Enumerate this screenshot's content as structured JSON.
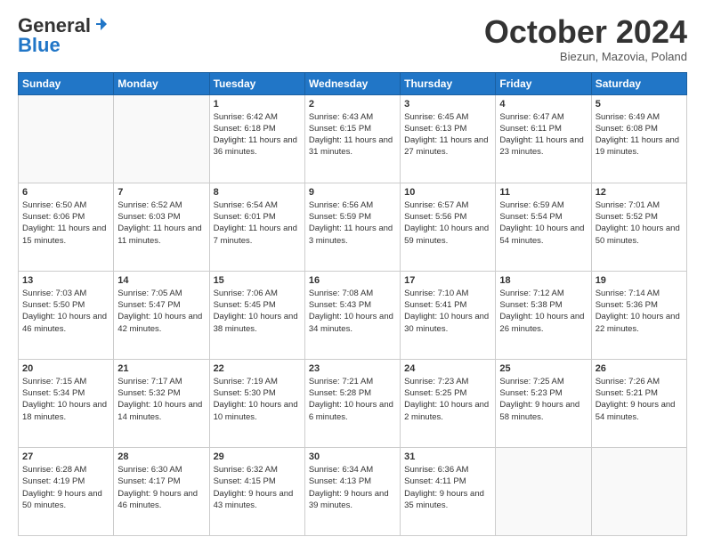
{
  "header": {
    "logo_line1": "General",
    "logo_line2": "Blue",
    "month": "October 2024",
    "location": "Biezun, Mazovia, Poland"
  },
  "days_of_week": [
    "Sunday",
    "Monday",
    "Tuesday",
    "Wednesday",
    "Thursday",
    "Friday",
    "Saturday"
  ],
  "weeks": [
    [
      {
        "num": "",
        "info": ""
      },
      {
        "num": "",
        "info": ""
      },
      {
        "num": "1",
        "info": "Sunrise: 6:42 AM\nSunset: 6:18 PM\nDaylight: 11 hours and 36 minutes."
      },
      {
        "num": "2",
        "info": "Sunrise: 6:43 AM\nSunset: 6:15 PM\nDaylight: 11 hours and 31 minutes."
      },
      {
        "num": "3",
        "info": "Sunrise: 6:45 AM\nSunset: 6:13 PM\nDaylight: 11 hours and 27 minutes."
      },
      {
        "num": "4",
        "info": "Sunrise: 6:47 AM\nSunset: 6:11 PM\nDaylight: 11 hours and 23 minutes."
      },
      {
        "num": "5",
        "info": "Sunrise: 6:49 AM\nSunset: 6:08 PM\nDaylight: 11 hours and 19 minutes."
      }
    ],
    [
      {
        "num": "6",
        "info": "Sunrise: 6:50 AM\nSunset: 6:06 PM\nDaylight: 11 hours and 15 minutes."
      },
      {
        "num": "7",
        "info": "Sunrise: 6:52 AM\nSunset: 6:03 PM\nDaylight: 11 hours and 11 minutes."
      },
      {
        "num": "8",
        "info": "Sunrise: 6:54 AM\nSunset: 6:01 PM\nDaylight: 11 hours and 7 minutes."
      },
      {
        "num": "9",
        "info": "Sunrise: 6:56 AM\nSunset: 5:59 PM\nDaylight: 11 hours and 3 minutes."
      },
      {
        "num": "10",
        "info": "Sunrise: 6:57 AM\nSunset: 5:56 PM\nDaylight: 10 hours and 59 minutes."
      },
      {
        "num": "11",
        "info": "Sunrise: 6:59 AM\nSunset: 5:54 PM\nDaylight: 10 hours and 54 minutes."
      },
      {
        "num": "12",
        "info": "Sunrise: 7:01 AM\nSunset: 5:52 PM\nDaylight: 10 hours and 50 minutes."
      }
    ],
    [
      {
        "num": "13",
        "info": "Sunrise: 7:03 AM\nSunset: 5:50 PM\nDaylight: 10 hours and 46 minutes."
      },
      {
        "num": "14",
        "info": "Sunrise: 7:05 AM\nSunset: 5:47 PM\nDaylight: 10 hours and 42 minutes."
      },
      {
        "num": "15",
        "info": "Sunrise: 7:06 AM\nSunset: 5:45 PM\nDaylight: 10 hours and 38 minutes."
      },
      {
        "num": "16",
        "info": "Sunrise: 7:08 AM\nSunset: 5:43 PM\nDaylight: 10 hours and 34 minutes."
      },
      {
        "num": "17",
        "info": "Sunrise: 7:10 AM\nSunset: 5:41 PM\nDaylight: 10 hours and 30 minutes."
      },
      {
        "num": "18",
        "info": "Sunrise: 7:12 AM\nSunset: 5:38 PM\nDaylight: 10 hours and 26 minutes."
      },
      {
        "num": "19",
        "info": "Sunrise: 7:14 AM\nSunset: 5:36 PM\nDaylight: 10 hours and 22 minutes."
      }
    ],
    [
      {
        "num": "20",
        "info": "Sunrise: 7:15 AM\nSunset: 5:34 PM\nDaylight: 10 hours and 18 minutes."
      },
      {
        "num": "21",
        "info": "Sunrise: 7:17 AM\nSunset: 5:32 PM\nDaylight: 10 hours and 14 minutes."
      },
      {
        "num": "22",
        "info": "Sunrise: 7:19 AM\nSunset: 5:30 PM\nDaylight: 10 hours and 10 minutes."
      },
      {
        "num": "23",
        "info": "Sunrise: 7:21 AM\nSunset: 5:28 PM\nDaylight: 10 hours and 6 minutes."
      },
      {
        "num": "24",
        "info": "Sunrise: 7:23 AM\nSunset: 5:25 PM\nDaylight: 10 hours and 2 minutes."
      },
      {
        "num": "25",
        "info": "Sunrise: 7:25 AM\nSunset: 5:23 PM\nDaylight: 9 hours and 58 minutes."
      },
      {
        "num": "26",
        "info": "Sunrise: 7:26 AM\nSunset: 5:21 PM\nDaylight: 9 hours and 54 minutes."
      }
    ],
    [
      {
        "num": "27",
        "info": "Sunrise: 6:28 AM\nSunset: 4:19 PM\nDaylight: 9 hours and 50 minutes."
      },
      {
        "num": "28",
        "info": "Sunrise: 6:30 AM\nSunset: 4:17 PM\nDaylight: 9 hours and 46 minutes."
      },
      {
        "num": "29",
        "info": "Sunrise: 6:32 AM\nSunset: 4:15 PM\nDaylight: 9 hours and 43 minutes."
      },
      {
        "num": "30",
        "info": "Sunrise: 6:34 AM\nSunset: 4:13 PM\nDaylight: 9 hours and 39 minutes."
      },
      {
        "num": "31",
        "info": "Sunrise: 6:36 AM\nSunset: 4:11 PM\nDaylight: 9 hours and 35 minutes."
      },
      {
        "num": "",
        "info": ""
      },
      {
        "num": "",
        "info": ""
      }
    ]
  ]
}
